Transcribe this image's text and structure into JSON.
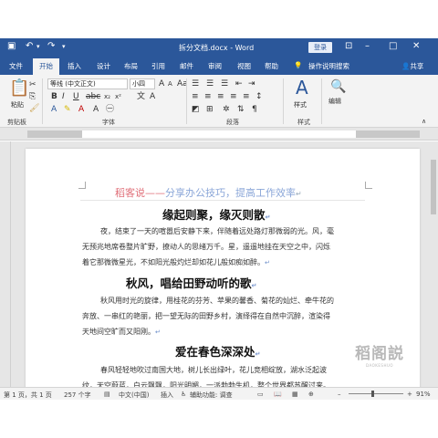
{
  "titlebar": {
    "doc_title": "拆分文档.docx - Word",
    "login_label": "登录",
    "accent": "#2b579a"
  },
  "tabs": [
    {
      "label": "文件"
    },
    {
      "label": "开始"
    },
    {
      "label": "插入"
    },
    {
      "label": "设计"
    },
    {
      "label": "布局"
    },
    {
      "label": "引用"
    },
    {
      "label": "邮件"
    },
    {
      "label": "审阅"
    },
    {
      "label": "视图"
    },
    {
      "label": "帮助"
    }
  ],
  "tell_me": "操作说明搜索",
  "share": "共享",
  "ribbon": {
    "paste_label": "粘贴",
    "clipboard_label": "剪贴板",
    "font_name": "等线 (中文正文)",
    "font_size": "小四",
    "font_label": "字体",
    "paragraph_label": "段落",
    "styles_label": "样式",
    "styles_group_label": "样式",
    "edit_label": "编辑"
  },
  "document": {
    "header_brand": "稻客说",
    "header_dash": "——",
    "header_slogan": "分享办公技巧，提高工作效率",
    "sections": [
      {
        "heading": "缘起则聚，缘灭则散",
        "lines": [
          "夜，结束了一天的喧嚣后安静下来，伴随着远处路灯那微弱的光。风，毫",
          "无预兆地席卷整片旷野，撩动人的思绪万千。星，遥遥地挂在天空之中，闪烁",
          "着它那微微星光，不如阳光般灼烂却如花儿般如痴如醉。"
        ]
      },
      {
        "heading": "秋风，唱给田野动听的歌",
        "lines": [
          "秋风用时光的旋律，用桂花的芬芳、苹果的馨香、菊花的灿烂、牵牛花的",
          "奔放、一串红的艳丽，把一望无际的田野乡村，演绎得在自然中沉醉，渲染得",
          "天地间空旷而又阳刚。"
        ]
      },
      {
        "heading": "爱在春色深深处",
        "lines": [
          "春风轻轻地吹过南国大地，树儿长出绿叶，花儿竞相绽放，湖水泛起波",
          "纹，天空蔚蓝，白云飘飘，阳光明媚，一派勃勃生机，整个世界都苏醒过来。"
        ]
      }
    ],
    "watermark_big": "稻阁説",
    "watermark_small": "DAOKESHUO"
  },
  "status": {
    "page": "第 1 页，共 1 页",
    "words": "257 个字",
    "language": "中文(中国)",
    "mode": "插入",
    "accessibility": "辅助功能: 调查",
    "zoom": "91%",
    "zoom_fraction": 0.91
  }
}
